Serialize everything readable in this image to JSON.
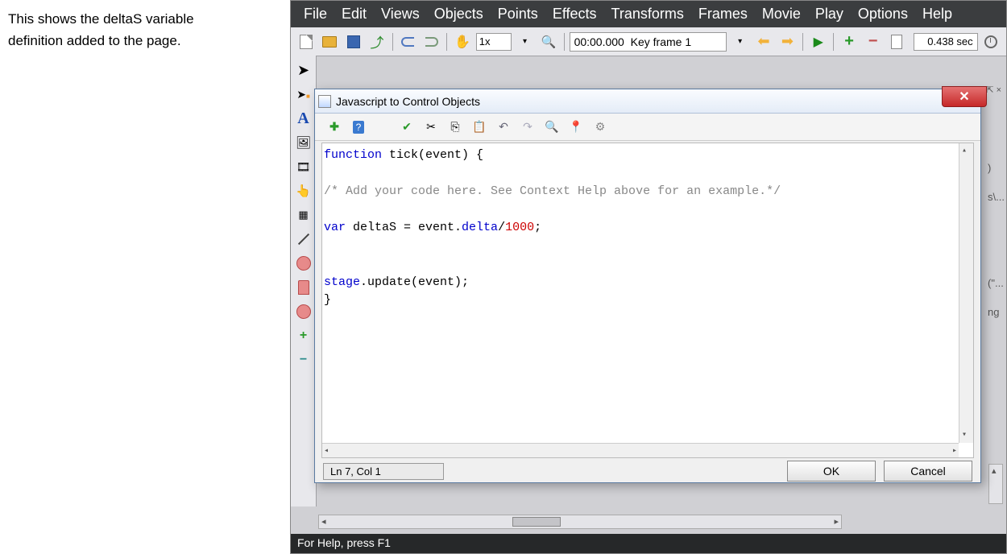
{
  "caption": "This shows the deltaS variable definition added to the page.",
  "menubar": [
    "File",
    "Edit",
    "Views",
    "Objects",
    "Points",
    "Effects",
    "Transforms",
    "Frames",
    "Movie",
    "Play",
    "Options",
    "Help"
  ],
  "toolbar": {
    "zoom": "1x",
    "frame": "00:00.000  Key frame 1",
    "seconds": "0.438 sec"
  },
  "dialog": {
    "title": "Javascript to Control Objects",
    "code": {
      "l1a": "function",
      "l1b": " tick(event) {",
      "l2": "/* Add your code here. See Context Help above for an example.*/",
      "l3a": "var",
      "l3b": " deltaS = event.",
      "l3c": "delta",
      "l3d": "/",
      "l3e": "1000",
      "l3f": ";",
      "l4a": "stage",
      "l4b": ".update(event);",
      "l5": "}"
    },
    "status": "Ln 7, Col 1",
    "ok": "OK",
    "cancel": "Cancel"
  },
  "statusbar": "For Help, press F1",
  "right_peek": {
    "a": ")",
    "b": "s\\...",
    "c": "(\"...",
    "d": "ng"
  },
  "pin_label": "⇱ ×"
}
